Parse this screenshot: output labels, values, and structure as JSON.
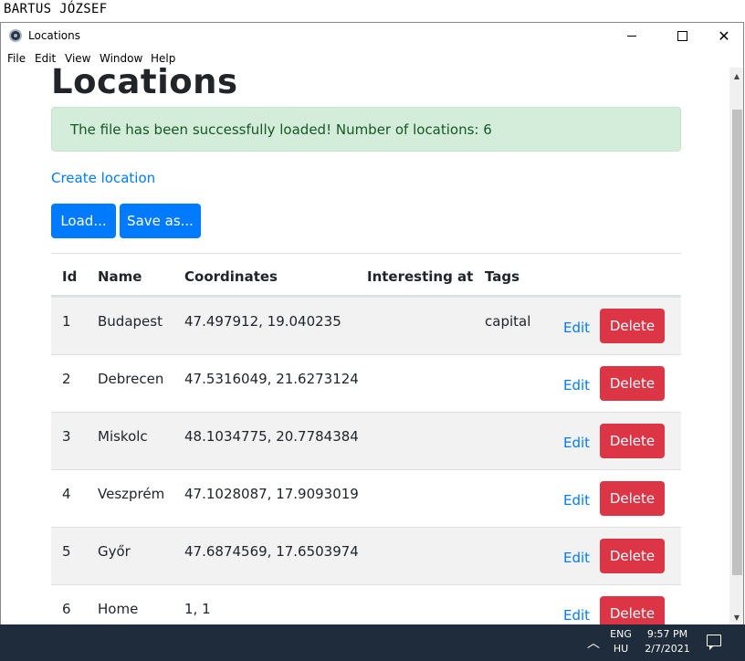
{
  "author": "BARTUS JÓZSEF",
  "window": {
    "title": "Locations",
    "minimize": "—",
    "maximize": "☐",
    "close": "✕"
  },
  "menu": [
    "File",
    "Edit",
    "View",
    "Window",
    "Help"
  ],
  "page": {
    "title": "Locations",
    "alert": "The file has been successfully loaded! Number of locations: 6",
    "create_link": "Create location",
    "load_button": "Load...",
    "save_button": "Save as..."
  },
  "table": {
    "headers": [
      "Id",
      "Name",
      "Coordinates",
      "Interesting at",
      "Tags"
    ],
    "rows": [
      {
        "id": "1",
        "name": "Budapest",
        "coordinates": "47.497912, 19.040235",
        "interesting_at": "",
        "tags": "capital",
        "edit": "Edit",
        "delete": "Delete"
      },
      {
        "id": "2",
        "name": "Debrecen",
        "coordinates": "47.5316049, 21.6273124",
        "interesting_at": "",
        "tags": "",
        "edit": "Edit",
        "delete": "Delete"
      },
      {
        "id": "3",
        "name": "Miskolc",
        "coordinates": "48.1034775, 20.7784384",
        "interesting_at": "",
        "tags": "",
        "edit": "Edit",
        "delete": "Delete"
      },
      {
        "id": "4",
        "name": "Veszprém",
        "coordinates": "47.1028087, 17.9093019",
        "interesting_at": "",
        "tags": "",
        "edit": "Edit",
        "delete": "Delete"
      },
      {
        "id": "5",
        "name": "Győr",
        "coordinates": "47.6874569, 17.6503974",
        "interesting_at": "",
        "tags": "",
        "edit": "Edit",
        "delete": "Delete"
      },
      {
        "id": "6",
        "name": "Home",
        "coordinates": "1, 1",
        "interesting_at": "",
        "tags": "",
        "edit": "Edit",
        "delete": "Delete"
      }
    ]
  },
  "taskbar": {
    "lang_top": "ENG",
    "lang_bottom": "HU",
    "time": "9:57 PM",
    "date": "2/7/2021",
    "chevron": "︿"
  },
  "colors": {
    "primary": "#007bff",
    "danger": "#dc3545",
    "success_bg": "#d4edda",
    "success_text": "#155724",
    "taskbar": "#1f2c3c"
  }
}
